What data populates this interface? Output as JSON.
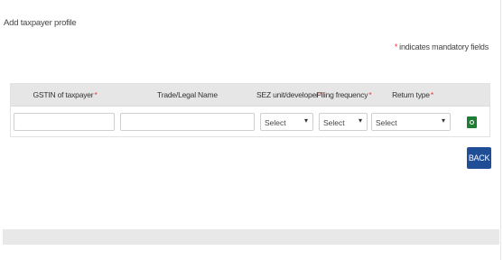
{
  "page": {
    "title": "Add taxpayer profile",
    "mandatory_star": "*",
    "mandatory_note": "indicates mandatory fields"
  },
  "table": {
    "headers": [
      {
        "label": "GSTIN of taxpayer",
        "required_mark": "*"
      },
      {
        "label": "Trade/Legal Name",
        "required_mark": ""
      },
      {
        "label": "SEZ unit/developer",
        "required_mark": "*"
      },
      {
        "label": "Filing frequency",
        "required_mark": "*"
      },
      {
        "label": "Return type",
        "required_mark": "*"
      }
    ],
    "row": {
      "gstin_value": "",
      "trade_name_value": "",
      "sez_selected": "Select",
      "filing_frequency_selected": "Select",
      "return_type_selected": "Select",
      "caret": "▾"
    }
  },
  "buttons": {
    "back_label": "BACK",
    "add_row_icon": "plus-circle-icon"
  },
  "colors": {
    "required": "#e53935",
    "primary_button": "#1f4e96",
    "add_button": "#1e7e34",
    "header_bg": "#e6e6e6"
  }
}
